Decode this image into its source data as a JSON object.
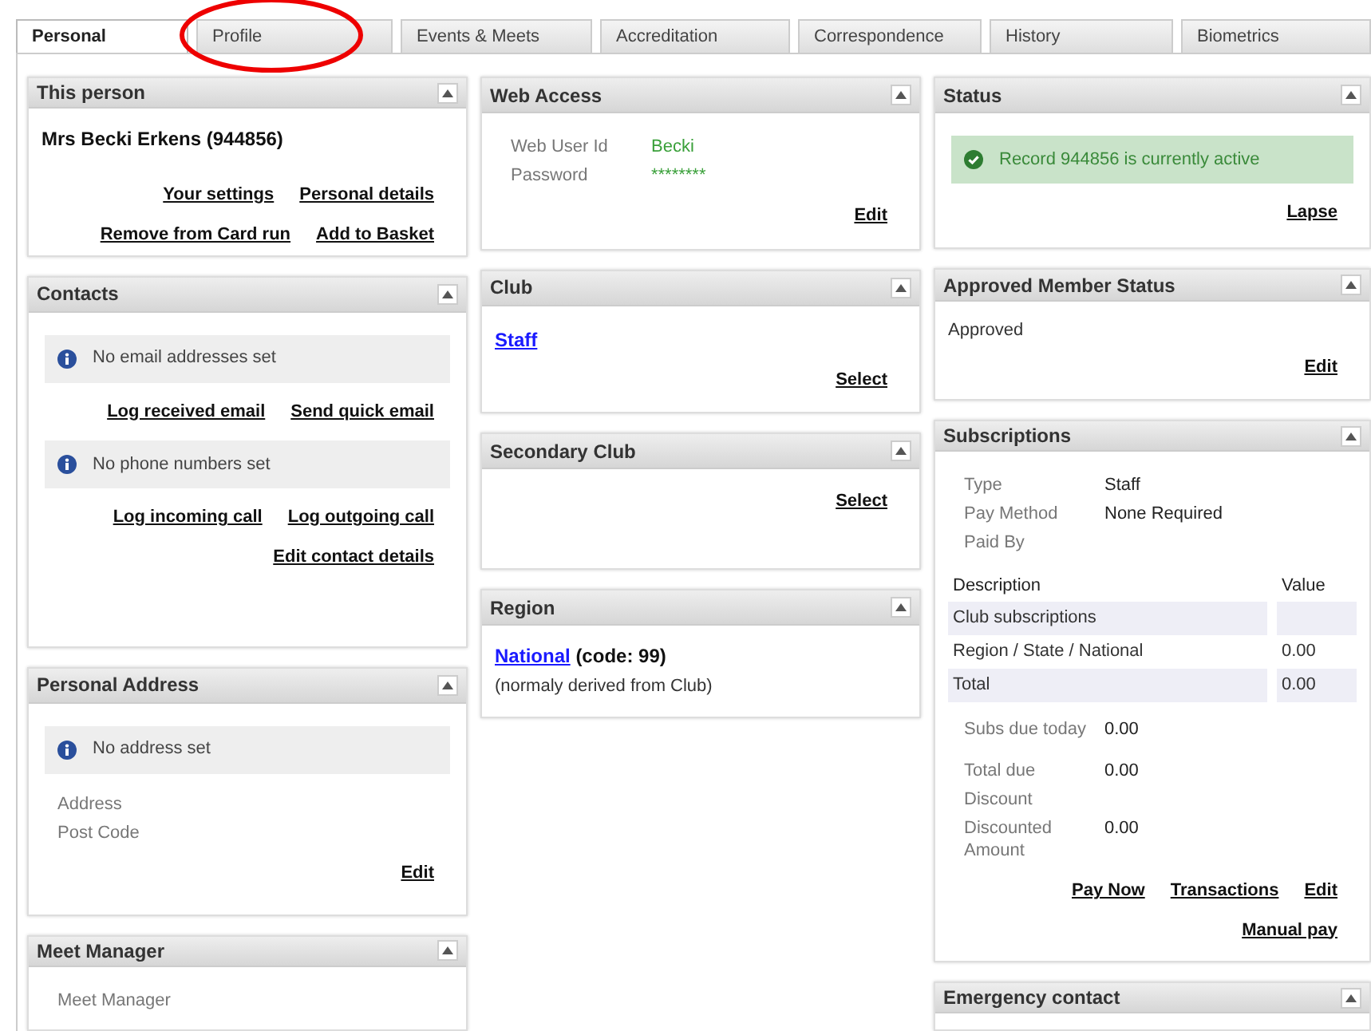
{
  "tabs": [
    {
      "label": "Personal",
      "selected": true
    },
    {
      "label": "Profile",
      "selected": false
    },
    {
      "label": "Events & Meets",
      "selected": false
    },
    {
      "label": "Accreditation",
      "selected": false
    },
    {
      "label": "Correspondence",
      "selected": false
    },
    {
      "label": "History",
      "selected": false
    },
    {
      "label": "Biometrics",
      "selected": false
    }
  ],
  "columns": [
    {
      "panels": [
        {
          "title": "This person",
          "items": [
            {
              "kind": "name",
              "text": "Mrs Becki Erkens (944856)"
            },
            {
              "kind": "actions",
              "links": [
                "Your settings",
                "Personal details"
              ]
            },
            {
              "kind": "actions",
              "links": [
                "Remove from Card run",
                "Add to Basket"
              ]
            }
          ]
        },
        {
          "title": "Contacts",
          "items": [
            {
              "kind": "notice",
              "success": false,
              "text": "No email addresses set"
            },
            {
              "kind": "actions",
              "links": [
                "Log received email",
                "Send quick email"
              ]
            },
            {
              "kind": "notice",
              "success": false,
              "text": "No phone numbers set"
            },
            {
              "kind": "actions",
              "links": [
                "Log incoming call",
                "Log outgoing call"
              ]
            },
            {
              "kind": "actions",
              "links": [
                "Edit contact details"
              ]
            }
          ]
        },
        {
          "title": "Personal Address",
          "items": [
            {
              "kind": "notice",
              "success": false,
              "text": "No address set"
            },
            {
              "kind": "fields",
              "rows": [
                {
                  "label": "Address"
                },
                {
                  "label": "Post Code"
                }
              ]
            },
            {
              "kind": "actions",
              "links": [
                "Edit"
              ]
            }
          ]
        },
        {
          "title": "Meet Manager",
          "items": [
            {
              "kind": "fields",
              "rows": [
                {
                  "label": "Meet Manager"
                }
              ]
            }
          ]
        }
      ]
    },
    {
      "panels": [
        {
          "title": "Web Access",
          "items": [
            {
              "kind": "fields",
              "highlighted": true,
              "rows": [
                {
                  "label": "Web User Id",
                  "value": "Becki"
                },
                {
                  "label": "Password",
                  "value": "********"
                }
              ]
            },
            {
              "kind": "actions",
              "links": [
                "Edit"
              ]
            }
          ]
        },
        {
          "title": "Club",
          "items": [
            {
              "kind": "link",
              "text": "Staff"
            },
            {
              "kind": "actions",
              "links": [
                "Select"
              ]
            }
          ]
        },
        {
          "title": "Secondary Club",
          "items": [
            {
              "kind": "actions",
              "links": [
                "Select"
              ]
            }
          ]
        },
        {
          "title": "Region",
          "items": [
            {
              "kind": "linked_text",
              "link": "National",
              "rest": "(code: 99)"
            },
            {
              "kind": "text",
              "text": "(normaly derived from Club)"
            }
          ]
        }
      ]
    },
    {
      "panels": [
        {
          "title": "Status",
          "items": [
            {
              "kind": "notice",
              "success": true,
              "text": "Record 944856 is currently active"
            },
            {
              "kind": "actions",
              "links": [
                "Lapse"
              ]
            }
          ]
        },
        {
          "title": "Approved Member Status",
          "items": [
            {
              "kind": "text",
              "text": "Approved"
            },
            {
              "kind": "actions",
              "links": [
                "Edit"
              ]
            }
          ]
        },
        {
          "title": "Subscriptions",
          "items": [
            {
              "kind": "fields",
              "rows": [
                {
                  "label": "Type",
                  "value": "Staff"
                },
                {
                  "label": "Pay Method",
                  "value": "None Required"
                },
                {
                  "label": "Paid By"
                }
              ]
            },
            {
              "kind": "table",
              "columns": [
                "Description",
                "Value"
              ],
              "rows": [
                {
                  "shaded": true,
                  "cells": [
                    "Club subscriptions",
                    ""
                  ]
                },
                {
                  "shaded": false,
                  "cells": [
                    "Region / State / National",
                    "0.00"
                  ]
                },
                {
                  "shaded": true,
                  "cells": [
                    "Total",
                    "0.00"
                  ]
                }
              ]
            },
            {
              "kind": "fields",
              "rows": [
                {
                  "label": "Subs due today",
                  "value": "0.00"
                }
              ]
            },
            {
              "kind": "fields",
              "rows": [
                {
                  "label": "Total due",
                  "value": "0.00"
                },
                {
                  "label": "Discount"
                },
                {
                  "label": "Discounted Amount",
                  "value": "0.00"
                }
              ]
            },
            {
              "kind": "actions",
              "links": [
                "Pay Now",
                "Transactions",
                "Edit"
              ]
            },
            {
              "kind": "actions",
              "links": [
                "Manual pay"
              ]
            }
          ]
        },
        {
          "title": "Emergency contact"
        }
      ]
    }
  ]
}
